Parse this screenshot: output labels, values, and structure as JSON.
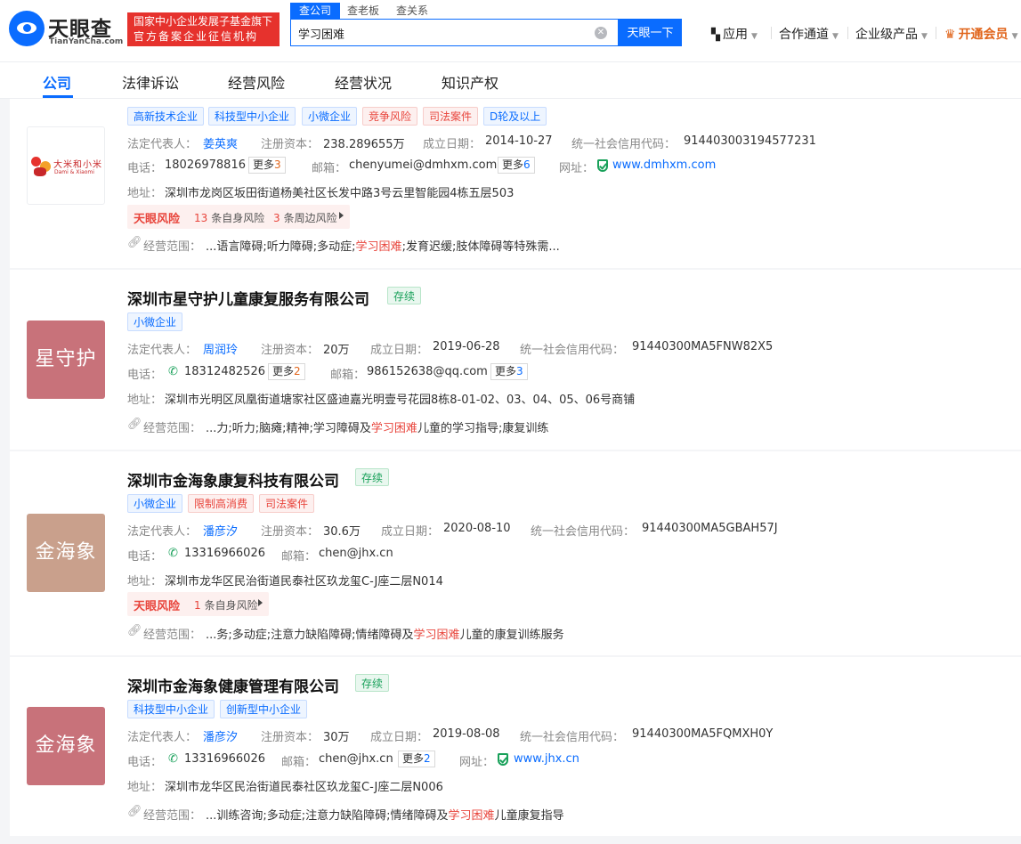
{
  "header": {
    "logo_cn": "天眼查",
    "logo_en": "TianYanCha.com",
    "slogan_line1": "国家中小企业发展子基金旗下",
    "slogan_line2": "官方备案企业征信机构",
    "search_tabs": [
      "查公司",
      "查老板",
      "查关系"
    ],
    "search_value": "学习困难",
    "search_button": "天眼一下",
    "nav": {
      "apps": "应用",
      "partner": "合作通道",
      "enterprise": "企业级产品",
      "vip": "开通会员"
    }
  },
  "tabs": [
    "公司",
    "法律诉讼",
    "经营风险",
    "经营状况",
    "知识产权"
  ],
  "labels": {
    "legal_rep": "法定代表人：",
    "capital": "注册资本：",
    "founded": "成立日期：",
    "credit_code": "统一社会信用代码：",
    "phone": "电话：",
    "email": "邮箱：",
    "website": "网址：",
    "address": "地址：",
    "scope": "经营范围：",
    "more": "更多",
    "risk_logo": "天眼风险",
    "self_risk": "条自身风险",
    "surround_risk": "条周边风险"
  },
  "colors": {
    "accent": "#0a6cff",
    "risk": "#e8453c",
    "status_green": "#19a15a"
  },
  "companies": [
    {
      "logo_text": "大米和小米",
      "logo_sub": "Dami & Xiaomi",
      "tags": [
        "高新技术企业",
        "科技型中小企业",
        "小微企业",
        "竞争风险",
        "司法案件",
        "D轮及以上"
      ],
      "legal_rep": "姜英爽",
      "capital": "238.289655万",
      "founded": "2014-10-27",
      "credit_code": "914403003194577231",
      "phone": "18026978816",
      "phone_more": "3",
      "email": "chenyumei@dmhxm.com",
      "email_more": "6",
      "website": "www.dmhxm.com",
      "address": "深圳市龙岗区坂田街道杨美社区长发中路3号云里智能园4栋五层503",
      "risk_self": "13",
      "risk_surround": "3",
      "scope_pre": "...语言障碍;听力障碍;多动症;",
      "scope_hl": "学习困难",
      "scope_post": ";发育迟缓;肢体障碍等特殊需..."
    },
    {
      "name": "深圳市星守护儿童康复服务有限公司",
      "status": "存续",
      "logo_text": "星守护",
      "tags": [
        "小微企业"
      ],
      "legal_rep": "周润玲",
      "capital": "20万",
      "founded": "2019-06-28",
      "credit_code": "91440300MA5FNW82X5",
      "phone": "18312482526",
      "phone_more": "2",
      "email": "986152638@qq.com",
      "email_more": "3",
      "address": "深圳市光明区凤凰街道塘家社区盛迪嘉光明壹号花园8栋8-01-02、03、04、05、06号商铺",
      "scope_pre": "...力;听力;脑瘫;精神;学习障碍及",
      "scope_hl": "学习困难",
      "scope_post": "儿童的学习指导;康复训练"
    },
    {
      "name": "深圳市金海象康复科技有限公司",
      "status": "存续",
      "logo_text": "金海象",
      "tags": [
        "小微企业",
        "限制高消费",
        "司法案件"
      ],
      "legal_rep": "潘彦汐",
      "capital": "30.6万",
      "founded": "2020-08-10",
      "credit_code": "91440300MA5GBAH57J",
      "phone": "13316966026",
      "email": "chen@jhx.cn",
      "address": "深圳市龙华区民治街道民泰社区玖龙玺C-J座二层N014",
      "risk_self": "1",
      "scope_pre": "...务;多动症;注意力缺陷障碍;情绪障碍及",
      "scope_hl": "学习困难",
      "scope_post": "儿童的康复训练服务"
    },
    {
      "name": "深圳市金海象健康管理有限公司",
      "status": "存续",
      "logo_text": "金海象",
      "tags": [
        "科技型中小企业",
        "创新型中小企业"
      ],
      "legal_rep": "潘彦汐",
      "capital": "30万",
      "founded": "2019-08-08",
      "credit_code": "91440300MA5FQMXH0Y",
      "phone": "13316966026",
      "email": "chen@jhx.cn",
      "email_more": "2",
      "website": "www.jhx.cn",
      "address": "深圳市龙华区民治街道民泰社区玖龙玺C-J座二层N006",
      "scope_pre": "...训练咨询;多动症;注意力缺陷障碍;情绪障碍及",
      "scope_hl": "学习困难",
      "scope_post": "儿童康复指导"
    }
  ]
}
